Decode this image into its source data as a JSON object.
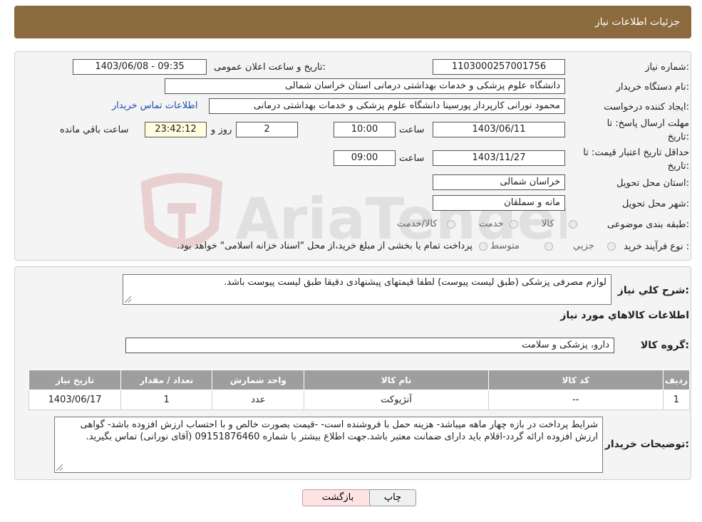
{
  "header": {
    "title": "جزئیات اطلاعات نیاز"
  },
  "fields": {
    "need_number_label": "شماره نیاز:",
    "need_number": "1103000257001756",
    "announce_label": "تاریخ و ساعت اعلان عمومی:",
    "announce_value": "1403/06/08 - 09:35",
    "buyer_org_label": "نام دستگاه خریدار:",
    "buyer_org": "دانشگاه علوم پزشکی و خدمات بهداشتی درمانی استان خراسان شمالی",
    "creator_label": "ایجاد کننده درخواست:",
    "creator": "محمود نورانی کارپرداز پورسینا دانشگاه علوم پزشکی و خدمات بهداشتی درمانی",
    "contact_link": "اطلاعات تماس خریدار",
    "deadline_label_1": "مهلت ارسال پاسخ: تا",
    "deadline_label_2": "تاریخ:",
    "deadline_date": "1403/06/11",
    "time_label": "ساعت",
    "deadline_time": "10:00",
    "days_value": "2",
    "days_label": "روز و",
    "remaining_time": "23:42:12",
    "remaining_label": "ساعت باقي مانده",
    "validity_label_1": "حداقل تاریخ اعتبار قیمت: تا",
    "validity_label_2": "تاریخ:",
    "validity_date": "1403/11/27",
    "validity_time": "09:00",
    "province_label": "استان محل تحویل:",
    "province": "خراسان شمالی",
    "city_label": "شهر محل تحویل:",
    "city": "مانه و سملقان",
    "category_label": "طبقه بندی موضوعی:",
    "category_options": [
      "کالا",
      "خدمت",
      "کالا/خدمت"
    ],
    "process_label": "نوع فرآیند خرید :",
    "process_options": [
      "جزیي",
      "متوسط"
    ],
    "process_note": "پرداخت تمام یا بخشی از مبلغ خرید،از محل \"اسناد خزانه اسلامی\" خواهد بود."
  },
  "summary": {
    "label": "شرح كلي نياز:",
    "text": "لوازم مصرفی پزشکی (طبق لیست پیوست) لطفا قیمتهای پیشنهادی دقیقا طبق لیست پیوست باشد."
  },
  "goods": {
    "section_title": "اطلاعات كالاهاي مورد نياز",
    "group_label": "گروه کالا:",
    "group_value": "دارو، پزشکی و سلامت",
    "columns": [
      "رديف",
      "کد کالا",
      "نام کالا",
      "واحد شمارش",
      "تعداد / مقدار",
      "تاریخ نیاز"
    ],
    "rows": [
      [
        "1",
        "--",
        "آنژیوکت",
        "عدد",
        "1",
        "1403/06/17"
      ]
    ]
  },
  "buyer_notes": {
    "label": "توضیحات خریدار:",
    "text": "شرایط پرداخت در بازه چهار ماهه میباشد- هزینه حمل با فروشنده است- -قیمت بصورت خالص و با احتساب ارزش افزوده باشد- گواهی ارزش افزوده ارائه گردد-اقلام باید دارای ضمانت معتبر باشد.جهت اطلاع بیشتر با شماره 09151876460 (آقای نورانی) تماس بگیرید."
  },
  "buttons": {
    "back": "بازگشت",
    "print": "چاپ"
  },
  "watermark": {
    "text": "AriaTender.neT"
  },
  "colors": {
    "header_bg": "#8b6b3d",
    "link": "#1a4fb3",
    "table_header": "#9e9e9e",
    "back_btn": "#fde3e3"
  }
}
